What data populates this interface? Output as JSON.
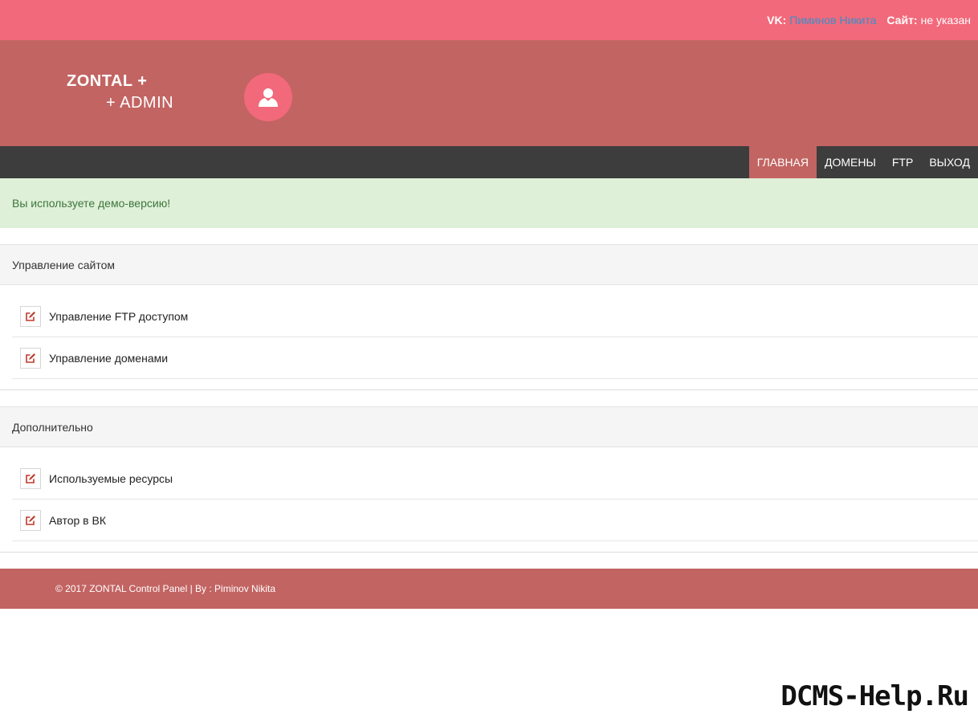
{
  "topbar": {
    "vk_label": "VK:",
    "vk_value": "Пиминов Никита",
    "site_label": "Сайт:",
    "site_value": "не указан"
  },
  "header": {
    "logo_line1": "ZONTAL +",
    "logo_line2": "+ ADMIN",
    "avatar_icon": "user-icon"
  },
  "nav": {
    "items": [
      {
        "label": "ГЛАВНАЯ",
        "active": true
      },
      {
        "label": "ДОМЕНЫ",
        "active": false
      },
      {
        "label": "FTP",
        "active": false
      },
      {
        "label": "ВЫХОД",
        "active": false
      }
    ]
  },
  "alert": {
    "text": "Вы используете демо-версию!"
  },
  "panels": [
    {
      "title": "Управление сайтом",
      "items": [
        {
          "label": "Управление FTP доступом",
          "icon": "edit-icon"
        },
        {
          "label": "Управление доменами",
          "icon": "edit-icon"
        }
      ]
    },
    {
      "title": "Дополнительно",
      "items": [
        {
          "label": "Используемые ресурсы",
          "icon": "edit-icon"
        },
        {
          "label": "Автор в ВК",
          "icon": "edit-icon"
        }
      ]
    }
  ],
  "footer": {
    "text": "© 2017 ZONTAL Control Panel | By : Piminov Nikita"
  },
  "watermark": {
    "text": "DCMS-Help.Ru"
  },
  "colors": {
    "topbar": "#f2697b",
    "header": "#c26462",
    "navbar": "#3d3d3d",
    "alert_bg": "#dff0d8",
    "alert_text": "#3c763d",
    "link": "#3c8fc9",
    "icon_accent": "#c0392b"
  }
}
